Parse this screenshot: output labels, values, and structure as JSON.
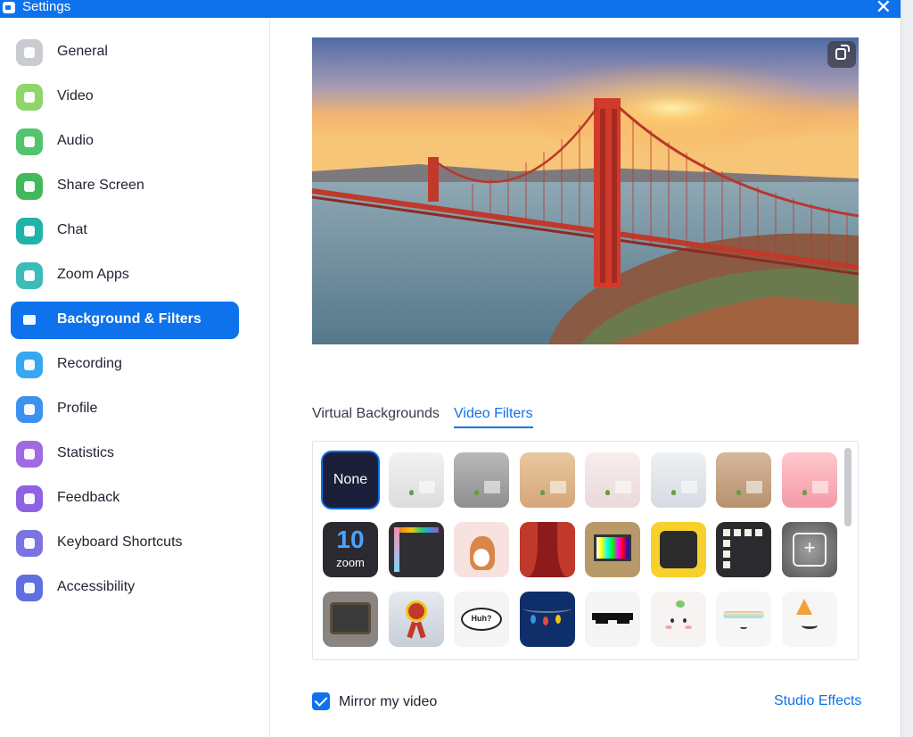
{
  "window": {
    "title": "Settings",
    "close_icon": "close-icon",
    "accent": "#0e72ed"
  },
  "sidebar": {
    "items": [
      {
        "label": "General",
        "icon": "gear-icon",
        "color": "#c9cbd1"
      },
      {
        "label": "Video",
        "icon": "video-camera-icon",
        "color": "#8fd66a"
      },
      {
        "label": "Audio",
        "icon": "headphones-icon",
        "color": "#53c46b"
      },
      {
        "label": "Share Screen",
        "icon": "share-screen-icon",
        "color": "#43b85c"
      },
      {
        "label": "Chat",
        "icon": "chat-icon",
        "color": "#20b3a8"
      },
      {
        "label": "Zoom Apps",
        "icon": "apps-icon",
        "color": "#3cbcb8"
      },
      {
        "label": "Background & Filters",
        "icon": "background-icon",
        "color": "#0e72ed",
        "active": true
      },
      {
        "label": "Recording",
        "icon": "record-icon",
        "color": "#36a8ef"
      },
      {
        "label": "Profile",
        "icon": "person-icon",
        "color": "#3d92f0"
      },
      {
        "label": "Statistics",
        "icon": "bar-chart-icon",
        "color": "#a26ae0"
      },
      {
        "label": "Feedback",
        "icon": "smiley-icon",
        "color": "#8f62e4"
      },
      {
        "label": "Keyboard Shortcuts",
        "icon": "keyboard-icon",
        "color": "#7c73e3"
      },
      {
        "label": "Accessibility",
        "icon": "accessibility-icon",
        "color": "#5f6fe0"
      }
    ]
  },
  "preview": {
    "image": "golden-gate-bridge-sunset",
    "rotate_icon": "rotate-icon"
  },
  "tabs": [
    {
      "label": "Virtual Backgrounds",
      "active": false
    },
    {
      "label": "Video Filters",
      "active": true
    }
  ],
  "filters": {
    "none_label": "None",
    "rows": [
      [
        "none",
        "white-room-filter",
        "gray-room-filter",
        "tan-room-filter",
        "pink-room-filter",
        "light-room-filter",
        "brown-room-filter",
        "rose-room-filter"
      ],
      [
        "zoom-10-filter",
        "rainbow-frame-filter",
        "corgi-filter",
        "red-curtain-filter",
        "retro-tv-filter",
        "emoji-frame-filter",
        "film-frame-filter",
        "add-filter-icon"
      ],
      [
        "old-tv-filter",
        "ribbon-badge-filter",
        "huh-speech-filter",
        "lights-filter",
        "sunglasses-filter",
        "sprout-face-filter",
        "rainbow-face-filter",
        "party-hat-filter"
      ]
    ],
    "huh_text": "Huh?",
    "zoom10_number": "10",
    "zoom10_word": "zoom"
  },
  "mirror": {
    "label": "Mirror my video",
    "checked": true
  },
  "studio_effects_label": "Studio Effects"
}
